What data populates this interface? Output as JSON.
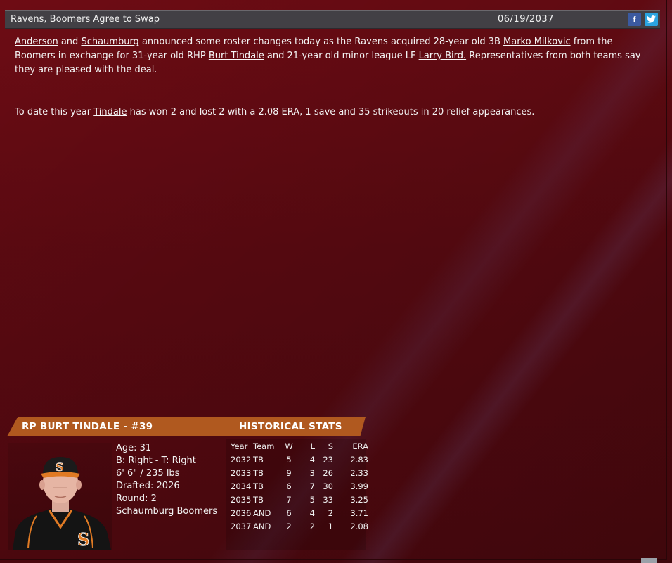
{
  "header": {
    "title": "Ravens, Boomers Agree to Swap",
    "date": "06/19/2037",
    "facebook_label": "f",
    "twitter_label": "t"
  },
  "article": {
    "p1": {
      "team1": "Anderson",
      "and": " and ",
      "team2": "Schaumburg",
      "t1": " announced some roster changes today as the Ravens acquired 28-year old 3B ",
      "player1": "Marko Milkovic",
      "t2": " from the Boomers in exchange for 31-year old RHP ",
      "player2": "Burt Tindale",
      "t3": " and 21-year old minor league LF ",
      "player3": "Larry Bird.",
      "t4": " Representatives from both teams say they are pleased with the deal."
    },
    "p2": {
      "t1": "To date this year ",
      "player": "Tindale",
      "t2": " has won 2 and lost 2 with a 2.08 ERA, 1 save and 35 strikeouts in 20 relief appearances."
    }
  },
  "player_card": {
    "title": "RP BURT TINDALE - #39",
    "hist_title": "HISTORICAL STATS",
    "bio": {
      "age": "Age: 31",
      "bats_throws": "B: Right - T: Right",
      "size": "6' 6\" / 235 lbs",
      "drafted": "Drafted: 2026",
      "round": "Round: 2",
      "team": "Schaumburg Boomers"
    },
    "stats": {
      "headers": [
        "Year",
        "Team",
        "W",
        "L",
        "S",
        "ERA"
      ],
      "rows": [
        [
          "2032",
          "TB",
          "5",
          "4",
          "23",
          "2.83"
        ],
        [
          "2033",
          "TB",
          "9",
          "3",
          "26",
          "2.33"
        ],
        [
          "2034",
          "TB",
          "6",
          "7",
          "30",
          "3.99"
        ],
        [
          "2035",
          "TB",
          "7",
          "5",
          "33",
          "3.25"
        ],
        [
          "2036",
          "AND",
          "6",
          "4",
          "2",
          "3.71"
        ],
        [
          "2037",
          "AND",
          "2",
          "2",
          "1",
          "2.08"
        ]
      ]
    }
  },
  "colors": {
    "background": "#5a0b12",
    "titlebar": "#424045",
    "card_header": "#b0591f",
    "facebook": "#3b5aa0",
    "twitter": "#2aa4e0"
  }
}
